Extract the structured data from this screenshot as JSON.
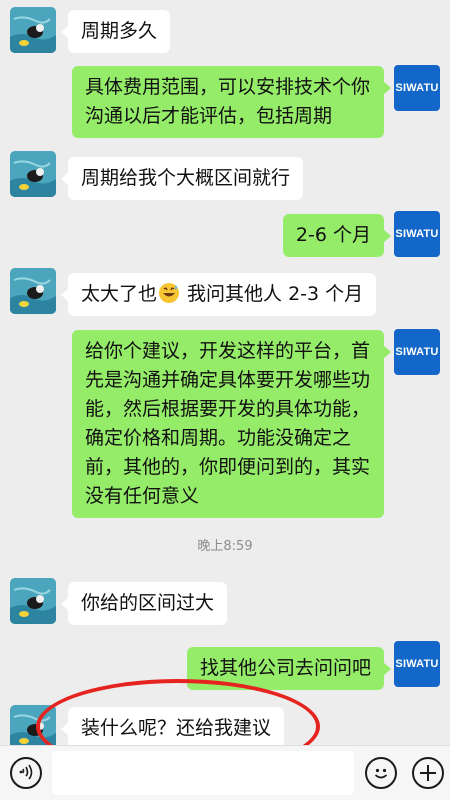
{
  "app": {
    "accent_in": "#ffffff",
    "accent_out": "#95ec69",
    "brand_avatar_color": "#1367c9"
  },
  "me": {
    "avatar_text": "SIWATU"
  },
  "messages": [
    {
      "side": "in",
      "text": "周期多久"
    },
    {
      "side": "out",
      "text": "具体费用范围，可以安排技术个你\n沟通以后才能评估，包括周期"
    },
    {
      "side": "in",
      "text": "周期给我个大概区间就行"
    },
    {
      "side": "out",
      "text": "2-6 个月"
    },
    {
      "side": "in",
      "text_before": "太大了也",
      "emoji": "grinning-sweat-emoji",
      "text_after": " 我问其他人 2-3 个月"
    },
    {
      "side": "out",
      "text": "给你个建议，开发这样的平台，首\n先是沟通并确定具体要开发哪些功\n能，然后根据要开发的具体功能，\n确定价格和周期。功能没确定之\n前，其他的，你即便问到的，其实\n没有任何意义"
    },
    {
      "side": "in",
      "text": "你给的区间过大"
    },
    {
      "side": "out",
      "text": "找其他公司去问问吧"
    },
    {
      "side": "in",
      "text": "装什么呢？还给我建议"
    }
  ],
  "timestamp": "晚上8:59",
  "input_bar": {
    "voice_icon": "voice-icon",
    "emoji_icon": "emoji-icon",
    "add_icon": "plus-icon"
  }
}
